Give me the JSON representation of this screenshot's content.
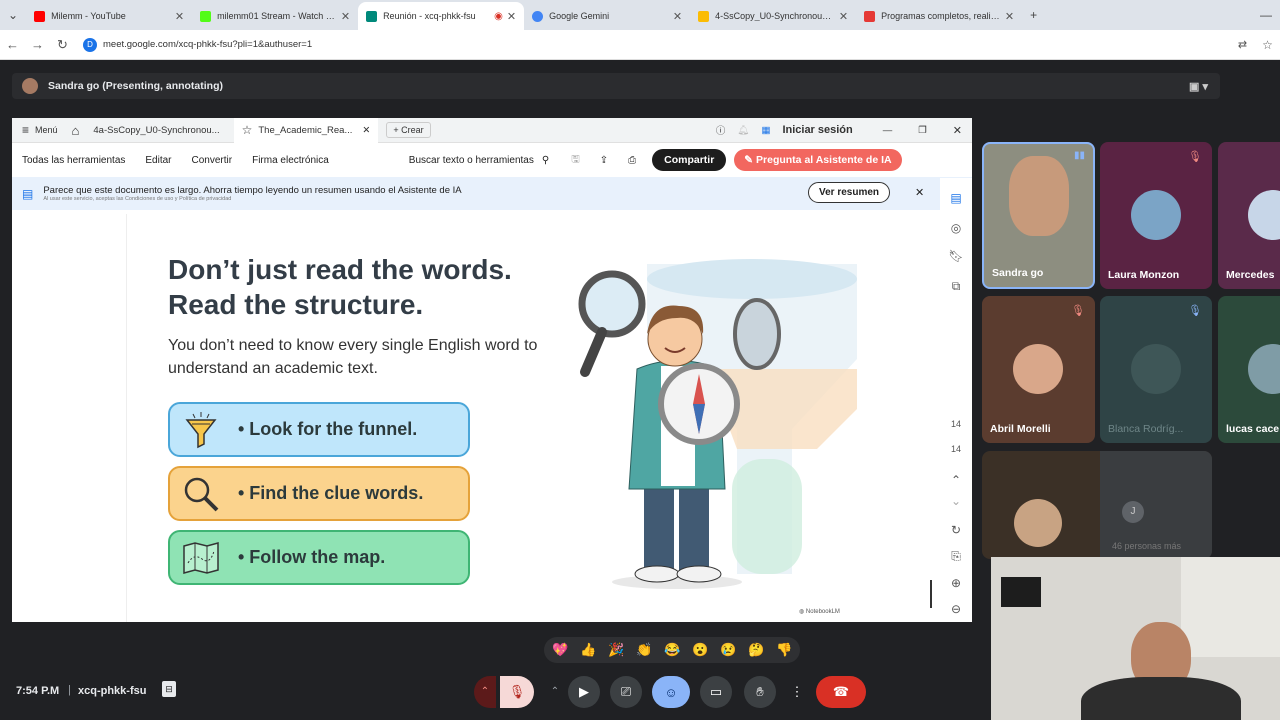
{
  "browser": {
    "tabs": [
      {
        "title": "Milemm - YouTube",
        "color": "#ff0000"
      },
      {
        "title": "milemm01 Stream - Watch Live",
        "color": "#53fc18"
      },
      {
        "title": "Reunión - xcq-phkk-fsu",
        "color": "#00897b",
        "active": true
      },
      {
        "title": "Google Gemini",
        "color": "#4285f4"
      },
      {
        "title": "4-SsCopy_U0-Synchronous Les",
        "color": "#fbbc04"
      },
      {
        "title": "Programas completos, realities",
        "color": "#e53935"
      }
    ],
    "new_tab": "+",
    "url": "meet.google.com/xcq-phkk-fsu?pli=1&authuser=1"
  },
  "meet": {
    "presenter_bar": "Sandra go (Presenting, annotating)",
    "time": "7:54 P.M",
    "separator": "|",
    "meeting_code": "xcq-phkk-fsu",
    "reactions": [
      "💖",
      "👍",
      "🎉",
      "👏",
      "😂",
      "😮",
      "😢",
      "🤔",
      "👎"
    ]
  },
  "pdf": {
    "tabs": {
      "menu": "Menú",
      "doc_tab_1": "4a-SsCopy_U0-Synchronou...",
      "doc_tab_2": "The_Academic_Rea...",
      "create": "Crear",
      "sign_in": "Iniciar sesión"
    },
    "tools": {
      "all_tools": "Todas las herramientas",
      "edit": "Editar",
      "convert": "Convertir",
      "esign": "Firma electrónica",
      "search": "Buscar texto o herramientas",
      "share": "Compartir",
      "ai": "Pregunta al Asistente de IA"
    },
    "banner": {
      "text": "Parece que este documento es largo. Ahorra tiempo leyendo un resumen usando el Asistente de IA",
      "small": "Al usar este servicio, aceptas las Condiciones de uso y Política de privacidad",
      "button": "Ver resumen"
    },
    "page_numbers": [
      "14",
      "14"
    ]
  },
  "slide": {
    "title_line1": "Don’t just read the words.",
    "title_line2": "Read the structure.",
    "subtitle": "You don’t need to know every single English word to understand an academic text.",
    "items": [
      {
        "label": "• Look for the funnel.",
        "bg": "#bfe6fb",
        "border": "#4aa6d9"
      },
      {
        "label": "• Find the clue words.",
        "bg": "#fbd38d",
        "border": "#e5a23a"
      },
      {
        "label": "• Follow the map.",
        "bg": "#8fe3b4",
        "border": "#3fb574"
      }
    ],
    "watermark": "NotebookLM"
  },
  "participants": [
    {
      "name": "Sandra go"
    },
    {
      "name": "Laura Monzon"
    },
    {
      "name": "Mercedes"
    },
    {
      "name": "Abril Morelli"
    },
    {
      "name": "Blanca Rodríg..."
    },
    {
      "name": "lucas cace"
    },
    {
      "name": "J"
    },
    {
      "name": "46 personas más"
    }
  ]
}
